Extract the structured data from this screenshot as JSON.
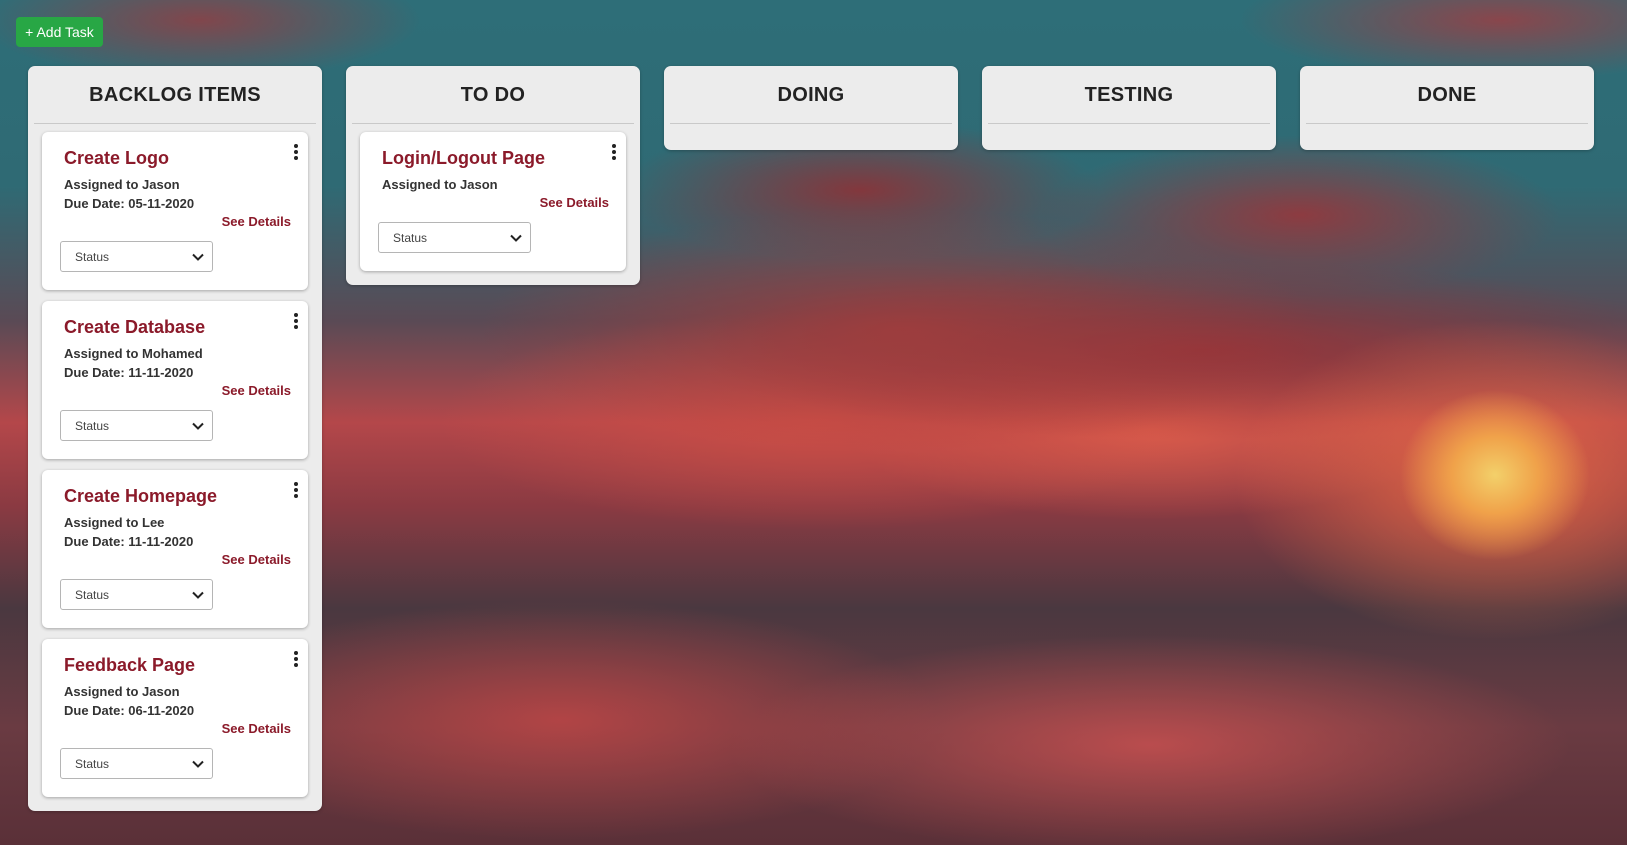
{
  "toolbar": {
    "add_task_label": "+ Add Task"
  },
  "colors": {
    "add_task_bg": "#28a745",
    "card_title": "#8b1a2a",
    "column_bg": "#ececec"
  },
  "columns": [
    {
      "title": "BACKLOG ITEMS",
      "cards": [
        {
          "title": "Create Logo",
          "assigned": "Assigned to Jason",
          "due": "Due Date: 05-11-2020",
          "details": "See Details",
          "status": "Status"
        },
        {
          "title": "Create Database",
          "assigned": "Assigned to Mohamed",
          "due": "Due Date: 11-11-2020",
          "details": "See Details",
          "status": "Status"
        },
        {
          "title": "Create Homepage",
          "assigned": "Assigned to Lee",
          "due": "Due Date: 11-11-2020",
          "details": "See Details",
          "status": "Status"
        },
        {
          "title": "Feedback Page",
          "assigned": "Assigned to Jason",
          "due": "Due Date: 06-11-2020",
          "details": "See Details",
          "status": "Status"
        }
      ]
    },
    {
      "title": "TO DO",
      "cards": [
        {
          "title": "Login/Logout Page",
          "assigned": "Assigned to Jason",
          "details": "See Details",
          "status": "Status"
        }
      ]
    },
    {
      "title": "DOING",
      "cards": []
    },
    {
      "title": "TESTING",
      "cards": []
    },
    {
      "title": "DONE",
      "cards": []
    }
  ],
  "icons": {
    "menu": "kebab-menu-icon",
    "select_arrow": "chevron-down-icon"
  }
}
